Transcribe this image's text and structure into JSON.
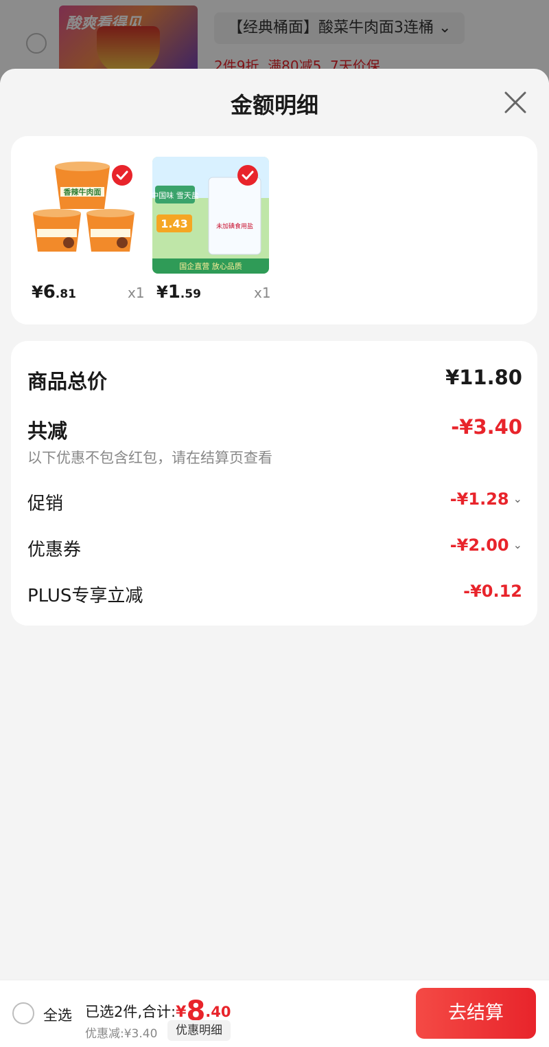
{
  "background": {
    "product_title": "【经典桶面】酸菜牛肉面3连桶 ⌄",
    "promo_tags": "2件9折  满80减5  7天价保",
    "thumb_text": "酸爽看得见"
  },
  "sheet": {
    "title": "金额明细"
  },
  "products": [
    {
      "price_yen": "¥",
      "price_int": "6",
      "price_dec": ".81",
      "qty": "x1",
      "thumb_text": "香辣牛肉面"
    },
    {
      "price_yen": "¥",
      "price_int": "1",
      "price_dec": ".59",
      "qty": "x1",
      "thumb_text": "中国味 雪天盐",
      "thumb_price": "1.43",
      "thumb_bag": "未加碘食用盐",
      "thumb_banner": "国企直营 放心品质"
    }
  ],
  "summary": {
    "total_label": "商品总价",
    "total_value": "¥11.80",
    "reduce_label": "共减",
    "reduce_value": "-¥3.40",
    "reduce_note": "以下优惠不包含红包，请在结算页查看",
    "items": [
      {
        "label": "促销",
        "value": "-¥1.28",
        "expandable": true
      },
      {
        "label": "优惠券",
        "value": "-¥2.00",
        "expandable": true
      },
      {
        "label": "PLUS专享立减",
        "value": "-¥0.12",
        "expandable": false
      }
    ]
  },
  "bottom": {
    "select_all": "全选",
    "selected_text": "已选2件,合计:",
    "total_yen": "¥",
    "total_int": "8",
    "total_dec": ".40",
    "discount_text": "优惠减:¥3.40",
    "detail_button": "优惠明细",
    "checkout_button": "去结算"
  },
  "colors": {
    "accent_red": "#e8242b",
    "sheet_background": "#f4f4f4"
  }
}
